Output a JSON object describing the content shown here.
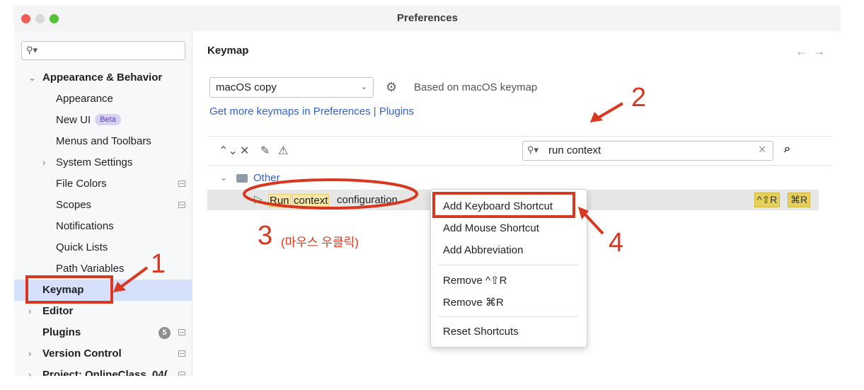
{
  "window": {
    "title": "Preferences"
  },
  "sidebar": {
    "search_placeholder": "",
    "items": [
      {
        "label": "Appearance & Behavior",
        "chevron": "⌄"
      },
      {
        "label": "Appearance"
      },
      {
        "label": "New UI",
        "badge": "Beta"
      },
      {
        "label": "Menus and Toolbars"
      },
      {
        "label": "System Settings",
        "chevron": "›"
      },
      {
        "label": "File Colors"
      },
      {
        "label": "Scopes"
      },
      {
        "label": "Notifications"
      },
      {
        "label": "Quick Lists"
      },
      {
        "label": "Path Variables"
      },
      {
        "label": "Keymap"
      },
      {
        "label": "Editor",
        "chevron": "›"
      },
      {
        "label": "Plugins",
        "badge": "5"
      },
      {
        "label": "Version Control",
        "chevron": "›"
      },
      {
        "label": "Project: OnlineClass_04(",
        "chevron": "›"
      }
    ]
  },
  "main": {
    "title": "Keymap",
    "nav_back": "←",
    "nav_forward": "→",
    "keymap_select": "macOS copy",
    "based_on": "Based on macOS keymap",
    "get_more_link": "Get more keymaps in Preferences | Plugins",
    "search_value": "run context",
    "tree": {
      "group": "Other",
      "action_parts": [
        "Run",
        "context",
        "configuration"
      ],
      "shortcuts": [
        "^⇧R",
        "⌘R"
      ]
    }
  },
  "context_menu": {
    "items": [
      "Add Keyboard Shortcut",
      "Add Mouse Shortcut",
      "Add Abbreviation",
      "Remove ^⇧R",
      "Remove ⌘R",
      "Reset Shortcuts"
    ]
  },
  "annotations": {
    "step1": "1",
    "step2": "2",
    "step3": "3",
    "step3_note": "(마우스 우클릭)",
    "step4": "4",
    "color": "#d8381f"
  },
  "icons": [
    "search-icon",
    "gear-icon",
    "expand-all-icon",
    "collapse-all-icon",
    "edit-icon",
    "warning-icon",
    "clear-icon",
    "find-by-shortcut-icon",
    "folder-icon",
    "run-icon"
  ]
}
